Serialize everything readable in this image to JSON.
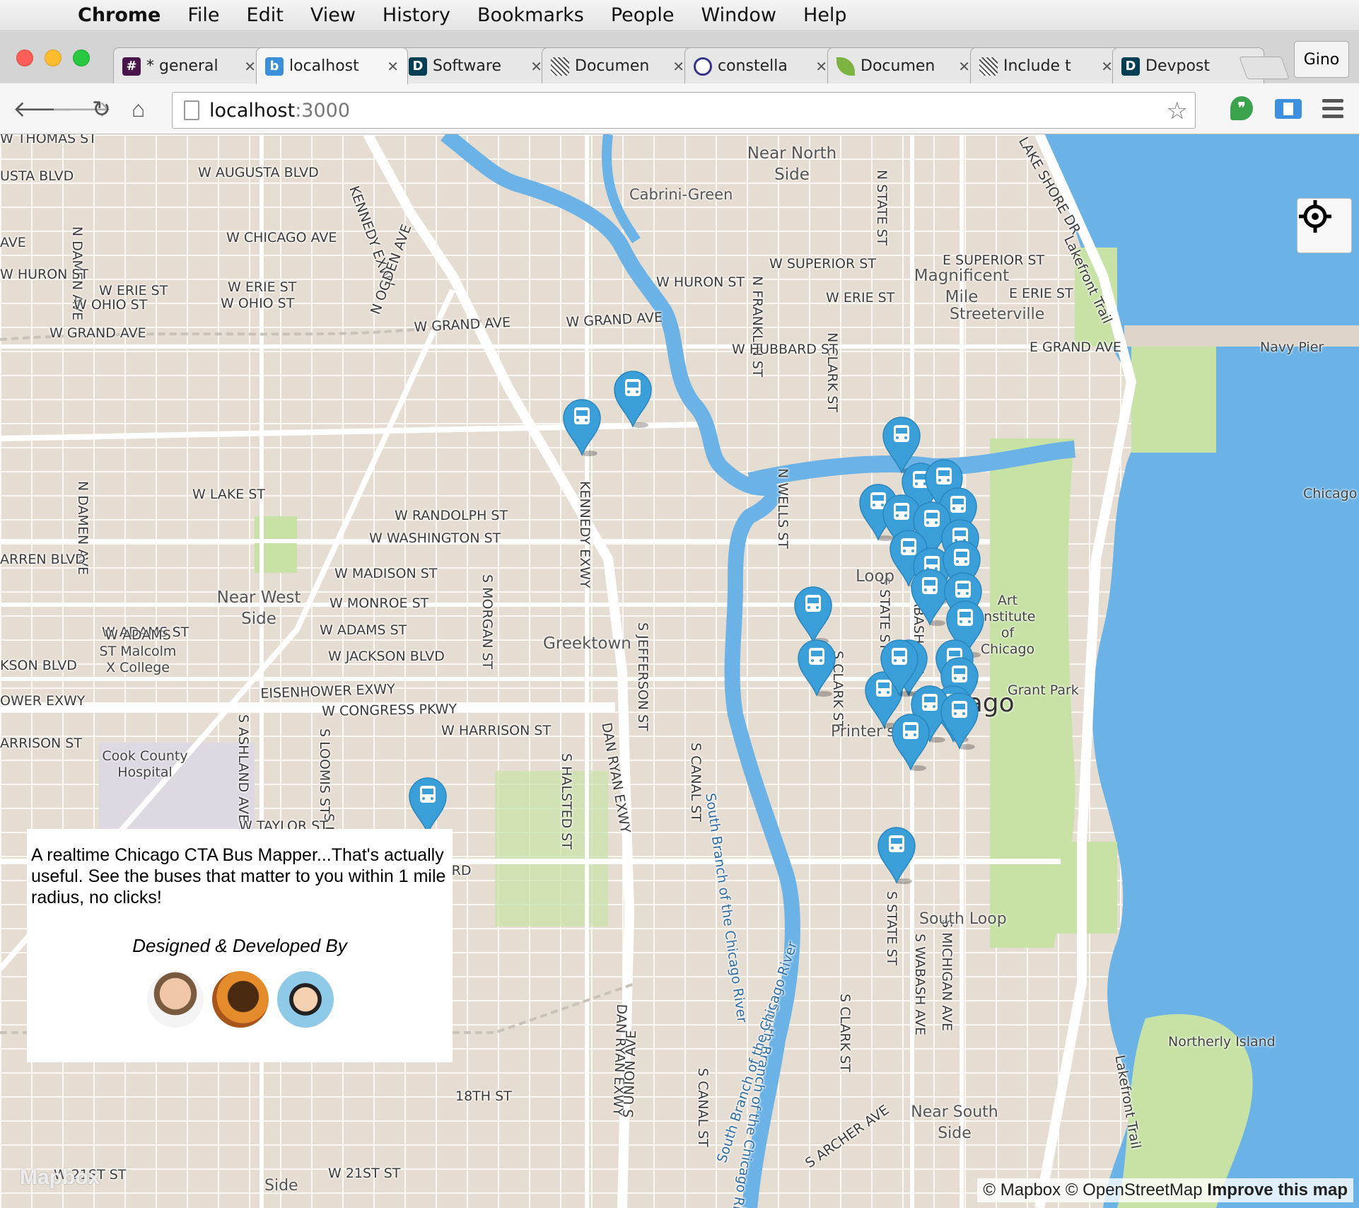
{
  "menubar": {
    "app": "Chrome",
    "items": [
      "File",
      "Edit",
      "View",
      "History",
      "Bookmarks",
      "People",
      "Window",
      "Help"
    ]
  },
  "tabs": [
    {
      "title": "* general",
      "icon": "#",
      "color": "#4a154b"
    },
    {
      "title": "localhost",
      "icon": "b",
      "color": "#3c8fd9"
    },
    {
      "title": "Software",
      "icon": "D",
      "color": "#003e54"
    },
    {
      "title": "Documen",
      "icon": "stripes",
      "color": "#555"
    },
    {
      "title": "constella",
      "icon": "globe",
      "color": "#333388"
    },
    {
      "title": "Documen",
      "icon": "leaf",
      "color": "#7cb342"
    },
    {
      "title": "Include t",
      "icon": "stripes",
      "color": "#888"
    },
    {
      "title": "Devpost",
      "icon": "D",
      "color": "#003e54"
    }
  ],
  "profile": "Gino",
  "url": {
    "host": "localhost",
    "port": ":3000"
  },
  "streets": [
    "W THOMAS ST",
    "USTA BLVD",
    "W AUGUSTA BLVD",
    "KENNEDY EXWY",
    "AVE",
    "W CHICAGO AVE",
    "N DAMEN AVE",
    "W HURON ST",
    "W ERIE ST",
    "W ERIE ST",
    "W OHIO ST",
    "W OHIO ST",
    "N OGDEN AVE",
    "W GRAND AVE",
    "W GRAND AVE",
    "W GRAND AVE",
    "W SUPERIOR ST",
    "W HURON ST",
    "N FRANKLIN ST",
    "W ERIE ST",
    "N CLARK ST",
    "W HUBBARD ST",
    "N STATE ST",
    "E SUPERIOR ST",
    "E ERIE ST",
    "E GRAND AVE",
    "LAKE SHORE DR",
    "Lakefront Trail",
    "W LAKE ST",
    "W RANDOLPH ST",
    "W WASHINGTON ST",
    "KENNEDY EXWY",
    "N DAMEN AVE",
    "ARREN BLVD",
    "W MADISON ST",
    "W MONROE ST",
    "W ADAMS ST",
    "W ADAMS ST",
    "W JACKSON BLVD",
    "KSON BLVD",
    "S MORGAN ST",
    "S JEFFERSON ST",
    "N WELLS ST",
    "S CLARK ST",
    "S STATE ST",
    "ABASH AVE",
    "OWER EXWY",
    "EISENHOWER EXWY",
    "W CONGRESS PKWY",
    "W HARRISON ST",
    "ARRISON ST",
    "S HALSTED ST",
    "DAN RYAN EXWY",
    "S CANAL ST",
    "S ASHLAND AVE",
    "S LOOMIS ST",
    "S LOOMIS ST",
    "W TAYLOR ST",
    "W ROOSEVELT RD",
    "S STATE ST",
    "S MICHIGAN AVE",
    "S WABASH AVE",
    "S CLARK ST",
    "DAN RYAN EXWY",
    "S UNION AVE",
    "S CANAL ST",
    "18TH ST",
    "W 21ST ST",
    "W 21ST ST",
    "S ARCHER AVE",
    "Lakefront Trail",
    "South Branch of the Chicago River",
    "South Branch of the Chicago River",
    "South Branch of the Chicago River"
  ],
  "neighborhoods": [
    "Near North Side",
    "Cabrini-Green",
    "Magnificent Mile",
    "Streeterville",
    "Navy Pier",
    "Chicago",
    "Near West Side",
    "Greektown",
    "Loop",
    "Art Institute of Chicago",
    "Grant Park",
    "Chicago",
    "Printer's Row",
    "South Loop",
    "Near South Side",
    "Northerly Island",
    "Side"
  ],
  "places": [
    "W ADAMS ST Malcolm X College",
    "Cook County Hospital"
  ],
  "bus_icon": "bus-marker-icon",
  "info": {
    "description": "A realtime Chicago CTA Bus Mapper...That's actually useful. See the buses that matter to you within 1 mile radius, no clicks!",
    "byline": "Designed & Developed By"
  },
  "attribution": {
    "a": "© Mapbox © OpenStreetMap",
    "b": "Improve this map"
  },
  "logo": "Mapbox",
  "colors": {
    "water": "#6bb3e6",
    "park": "#c8e2a6",
    "land": "#ede6dc",
    "marker": "#3a9fd9"
  }
}
